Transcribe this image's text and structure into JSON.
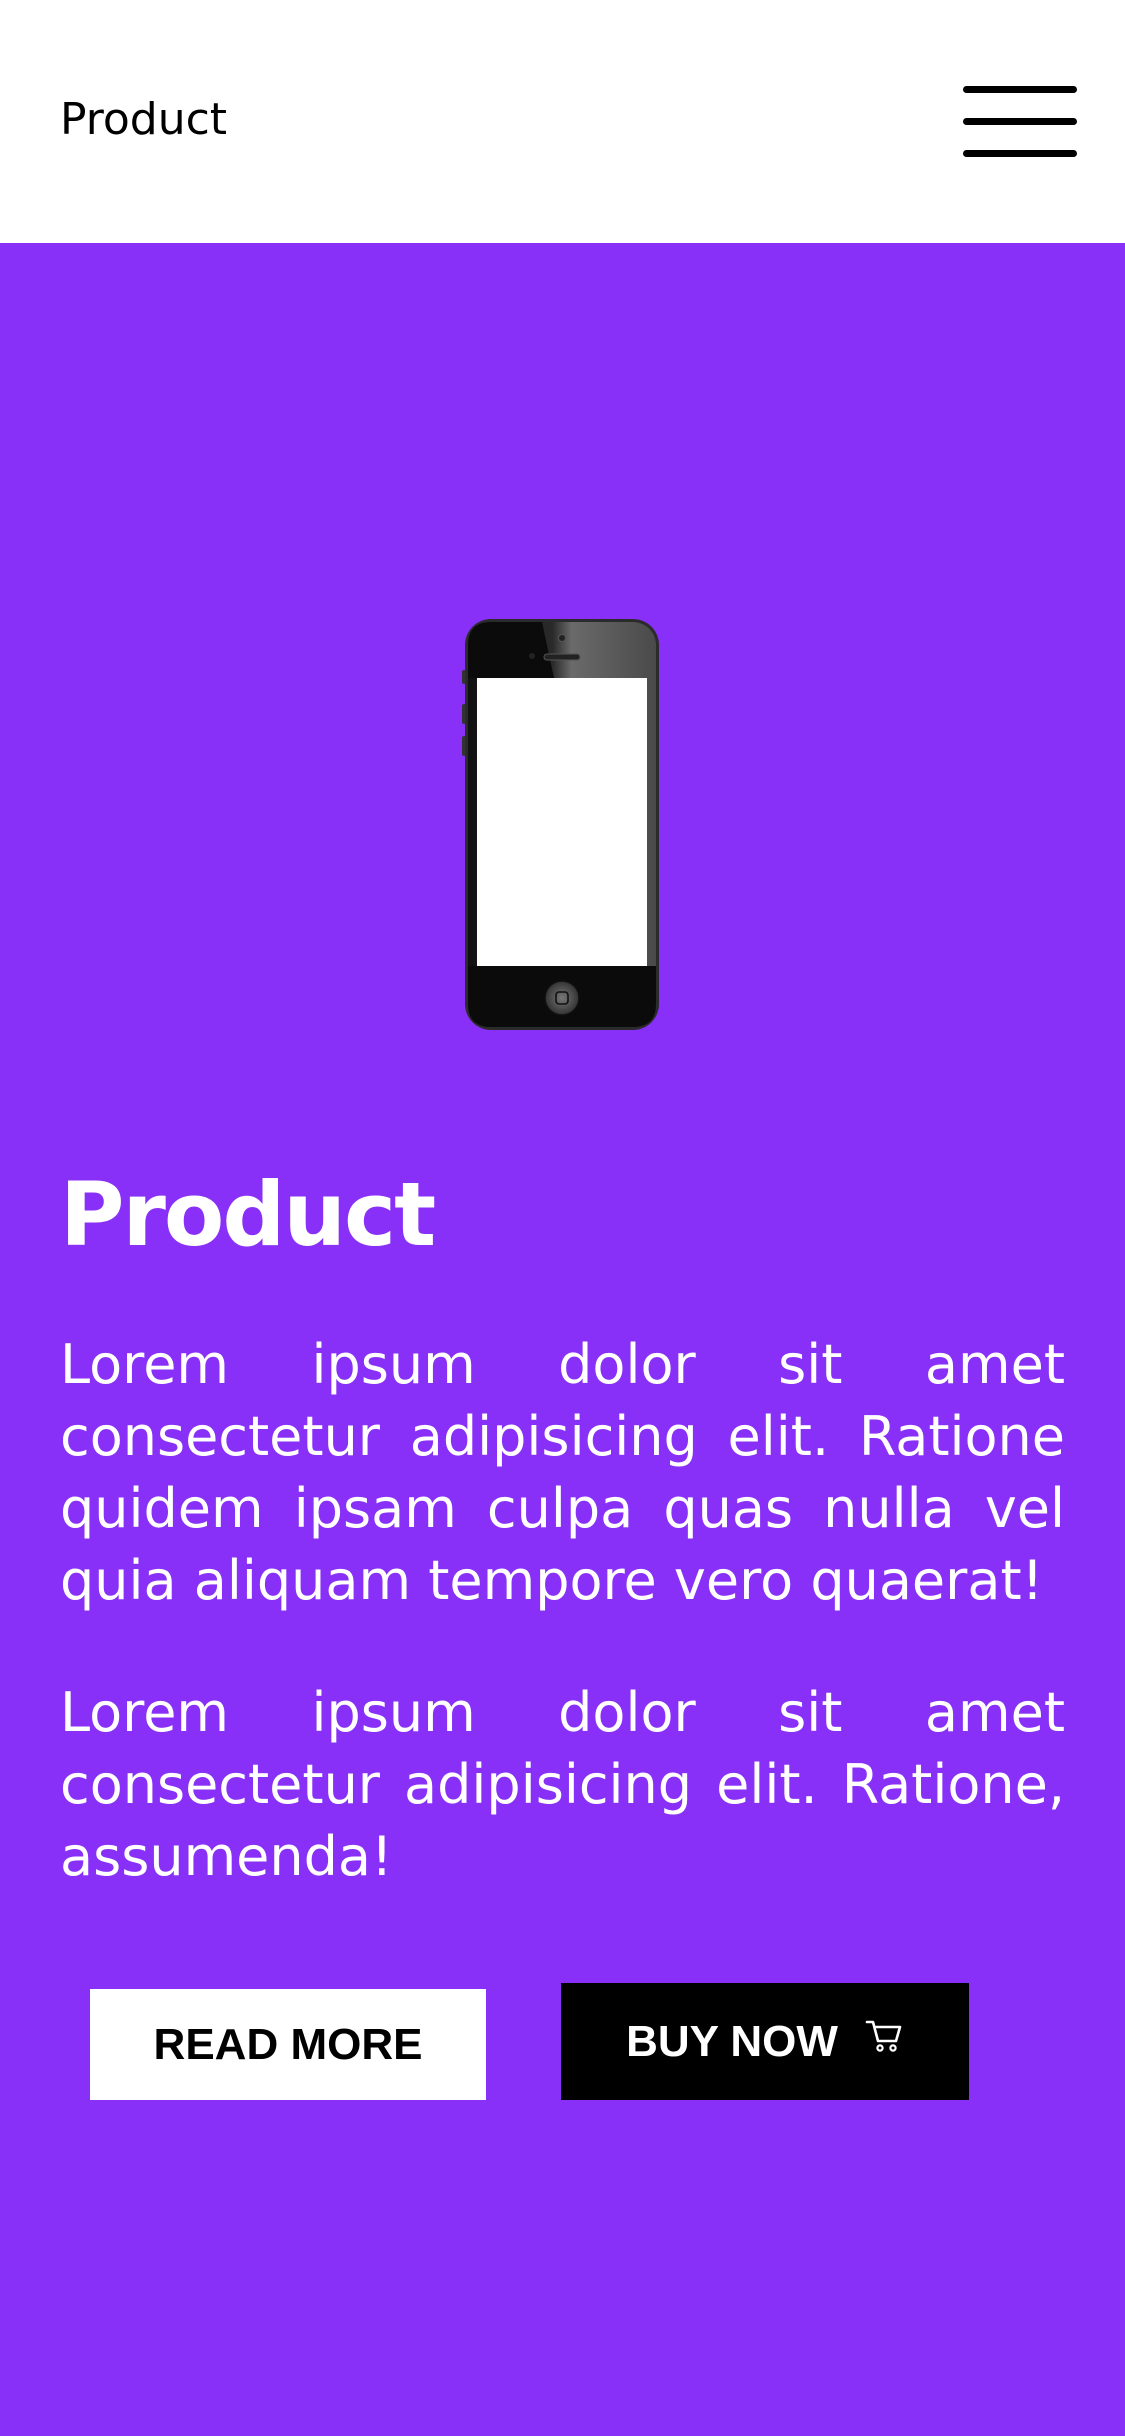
{
  "header": {
    "brand": "Product",
    "menu_icon": "hamburger-menu-icon"
  },
  "hero": {
    "image": "smartphone-image",
    "title": "Product",
    "paragraphs": [
      "Lorem ipsum dolor sit amet consectetur adipisicing elit. Ratione quidem ipsam culpa quas nulla vel quia aliquam tempore vero quaerat!",
      "Lorem ipsum dolor sit amet consectetur adipisicing elit. Ratione, assumenda!"
    ],
    "read_more_label": "READ MORE",
    "buy_now_label": "BUY NOW",
    "cart_icon": "shopping-cart-icon"
  },
  "colors": {
    "background": "#8830f7",
    "header_bg": "#ffffff",
    "text": "#ffffff",
    "read_more_bg": "#ffffff",
    "buy_now_bg": "#000000"
  }
}
